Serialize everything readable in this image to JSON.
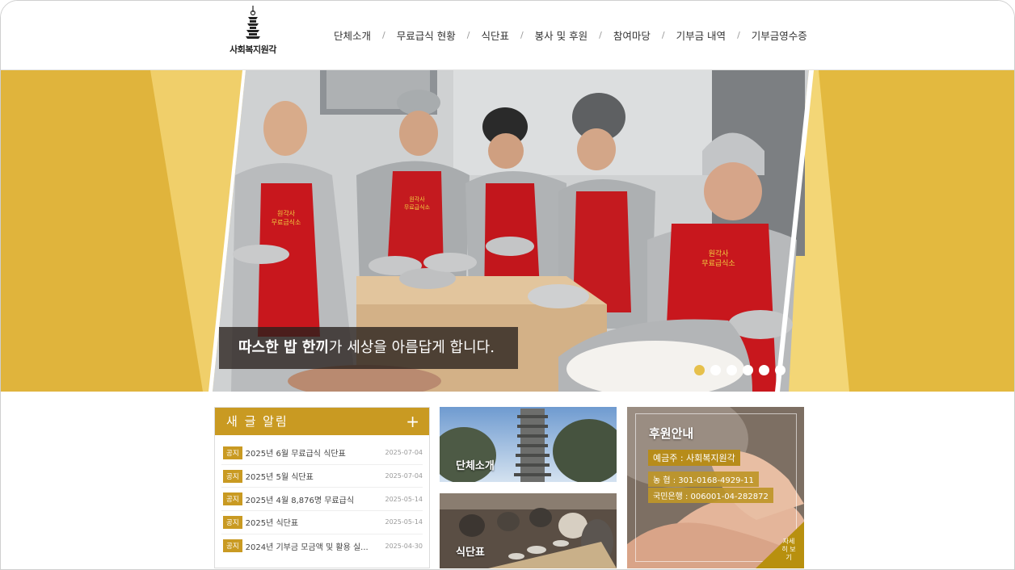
{
  "logo": {
    "text": "사회복지원각",
    "icon": "pagoda-icon"
  },
  "nav": {
    "items": [
      "단체소개",
      "무료급식 현황",
      "식단표",
      "봉사 및 후원",
      "참여마당",
      "기부금 내역",
      "기부금영수증"
    ]
  },
  "hero": {
    "caption_bold": "따스한 밥 한끼",
    "caption_rest": "가 세상을 아름답게 합니다.",
    "apron_text_1": "원각사",
    "apron_text_2": "무료급식소",
    "slide_count": 6,
    "active_slide": 1
  },
  "notice": {
    "title": "새 글 알림",
    "plus": "+",
    "items": [
      {
        "badge": "공지",
        "title": "2025년 6월 무료급식 식단표",
        "date": "2025-07-04"
      },
      {
        "badge": "공지",
        "title": "2025년 5월 식단표",
        "date": "2025-07-04"
      },
      {
        "badge": "공지",
        "title": "2025년 4월 8,876명 무료급식",
        "date": "2025-05-14"
      },
      {
        "badge": "공지",
        "title": "2025년 식단표",
        "date": "2025-05-14"
      },
      {
        "badge": "공지",
        "title": "2024년 기부금 모금액 및 활용 실...",
        "date": "2025-04-30"
      }
    ]
  },
  "cards": {
    "intro_label": "단체소개",
    "menu_label": "식단표"
  },
  "donate": {
    "title": "후원안내",
    "holder": "예금주 : 사회복지원각",
    "bank1": "농 협 :  301-0168-4929-11",
    "bank2": "국민은행 :  006001-04-282872",
    "more": "자세히 보기"
  },
  "colors": {
    "accent": "#c99a22",
    "hero_bg": "#e3b93f",
    "apron": "#c8171d"
  }
}
